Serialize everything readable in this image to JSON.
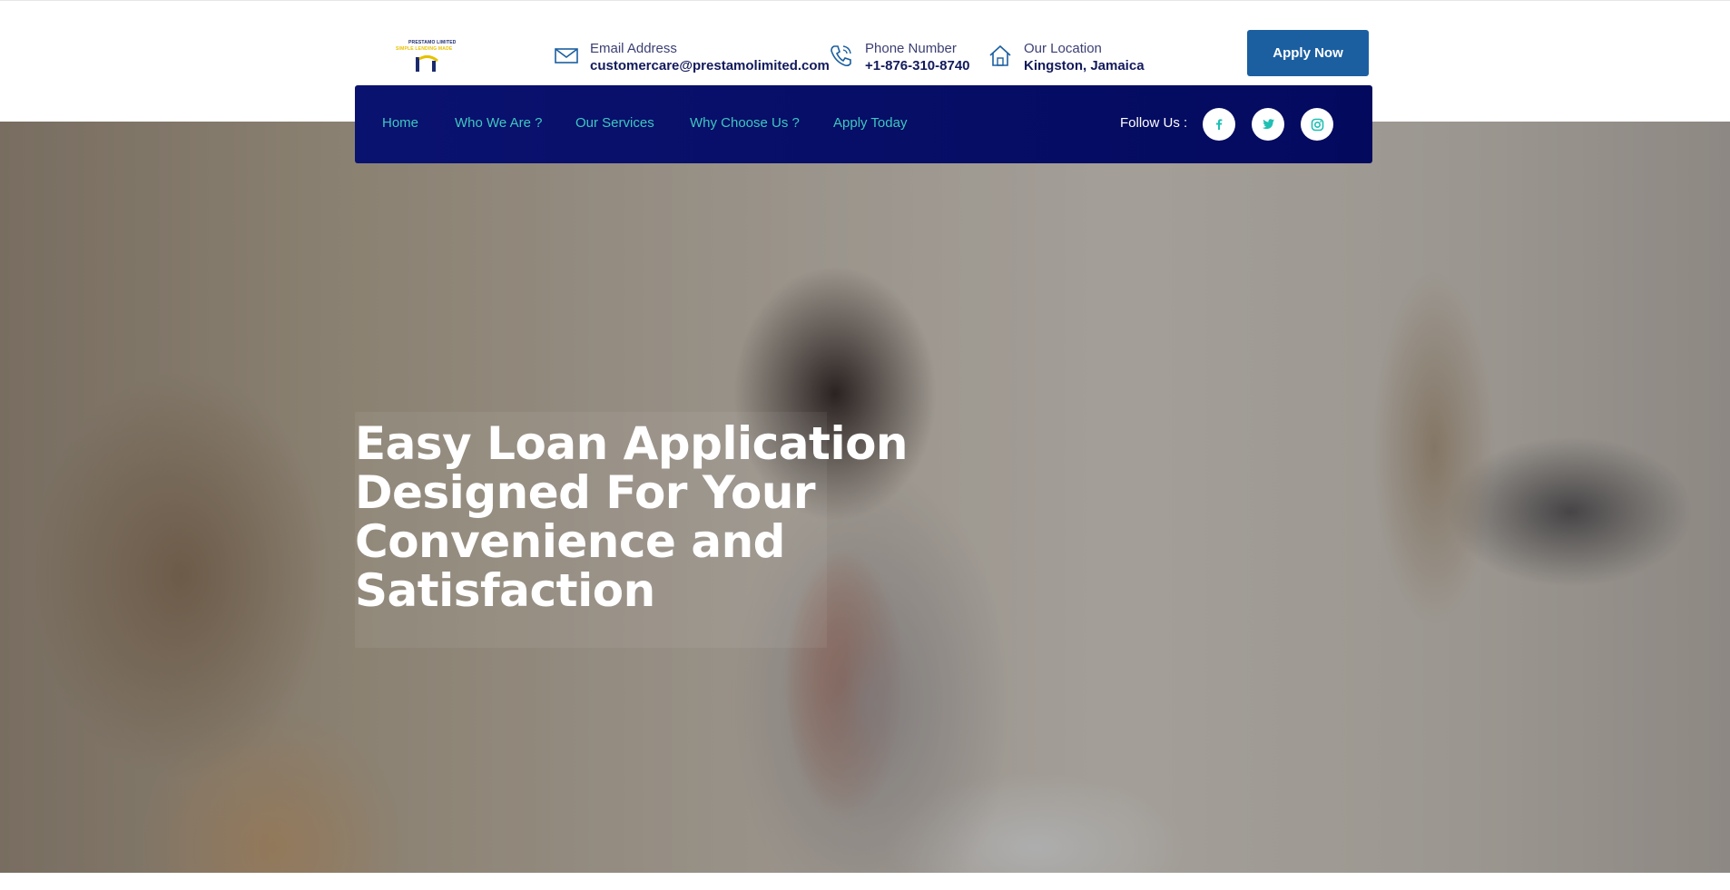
{
  "brand": {
    "logo_line1": "PRESTAMO LIMITED",
    "logo_line2": "SIMPLE LENDING MADE"
  },
  "contact": {
    "email": {
      "label": "Email Address",
      "value": "customercare@prestamolimited.com",
      "icon": "envelope-icon"
    },
    "phone": {
      "label": "Phone Number",
      "value": "+1-876-310-8740",
      "icon": "phone-icon"
    },
    "location": {
      "label": "Our Location",
      "value": "Kingston, Jamaica",
      "icon": "home-icon"
    }
  },
  "header": {
    "apply_button": "Apply Now"
  },
  "nav": {
    "items": [
      {
        "label": "Home"
      },
      {
        "label": "Who We Are ?"
      },
      {
        "label": "Our Services"
      },
      {
        "label": "Why Choose Us ?"
      },
      {
        "label": "Apply Today"
      }
    ],
    "follow_label": "Follow Us :",
    "social": [
      {
        "name": "facebook-icon"
      },
      {
        "name": "twitter-icon"
      },
      {
        "name": "instagram-icon"
      }
    ]
  },
  "hero": {
    "title_lines": [
      "Easy Loan Application",
      "Designed For Your",
      "Convenience and",
      "Satisfaction"
    ]
  },
  "colors": {
    "brand_blue": "#1b5fa0",
    "nav_bg": "#030a5e",
    "nav_link": "#3fc7c0",
    "text_dark": "#121a5c"
  }
}
